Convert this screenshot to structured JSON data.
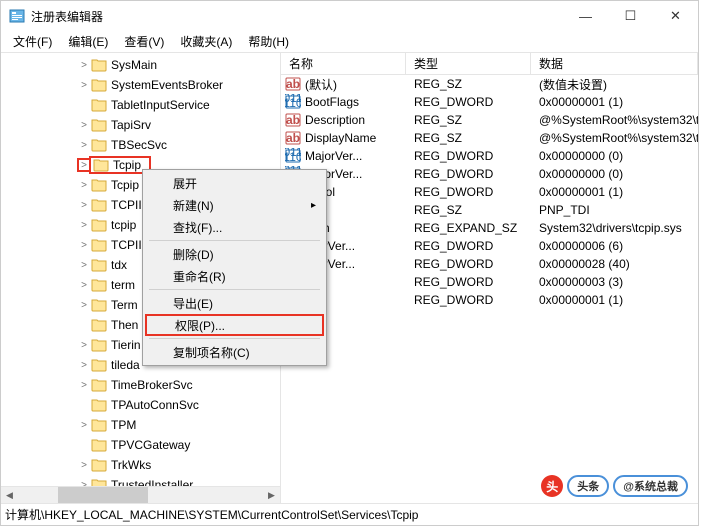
{
  "window": {
    "title": "注册表编辑器",
    "min": "—",
    "max": "☐",
    "close": "✕"
  },
  "menu": {
    "file": "文件(F)",
    "edit": "编辑(E)",
    "view": "查看(V)",
    "fav": "收藏夹(A)",
    "help": "帮助(H)"
  },
  "tree": {
    "items": [
      {
        "indent": 0,
        "chev": ">",
        "label": "SysMain"
      },
      {
        "indent": 0,
        "chev": ">",
        "label": "SystemEventsBroker"
      },
      {
        "indent": 0,
        "chev": "",
        "label": "TabletInputService"
      },
      {
        "indent": 0,
        "chev": ">",
        "label": "TapiSrv"
      },
      {
        "indent": 0,
        "chev": ">",
        "label": "TBSecSvc"
      },
      {
        "indent": 0,
        "chev": ">",
        "label": "Tcpip",
        "selected": true
      },
      {
        "indent": 0,
        "chev": ">",
        "label": "Tcpip"
      },
      {
        "indent": 0,
        "chev": ">",
        "label": "TCPII"
      },
      {
        "indent": 0,
        "chev": ">",
        "label": "tcpip"
      },
      {
        "indent": 0,
        "chev": ">",
        "label": "TCPII"
      },
      {
        "indent": 0,
        "chev": ">",
        "label": "tdx"
      },
      {
        "indent": 0,
        "chev": ">",
        "label": "term"
      },
      {
        "indent": 0,
        "chev": ">",
        "label": "Term"
      },
      {
        "indent": 0,
        "chev": "",
        "label": "Then"
      },
      {
        "indent": 0,
        "chev": ">",
        "label": "Tierin"
      },
      {
        "indent": 0,
        "chev": ">",
        "label": "tileda"
      },
      {
        "indent": 0,
        "chev": ">",
        "label": "TimeBrokerSvc"
      },
      {
        "indent": 0,
        "chev": "",
        "label": "TPAutoConnSvc"
      },
      {
        "indent": 0,
        "chev": ">",
        "label": "TPM"
      },
      {
        "indent": 0,
        "chev": "",
        "label": "TPVCGateway"
      },
      {
        "indent": 0,
        "chev": ">",
        "label": "TrkWks"
      },
      {
        "indent": 0,
        "chev": ">",
        "label": "TrustedInstaller"
      }
    ]
  },
  "columns": {
    "name": "名称",
    "type": "类型",
    "data": "数据"
  },
  "rows": [
    {
      "icon": "str",
      "name": "(默认)",
      "type": "REG_SZ",
      "data": "(数值未设置)"
    },
    {
      "icon": "bin",
      "name": "BootFlags",
      "type": "REG_DWORD",
      "data": "0x00000001 (1)"
    },
    {
      "icon": "str",
      "name": "Description",
      "type": "REG_SZ",
      "data": "@%SystemRoot%\\system32\\tc"
    },
    {
      "icon": "str",
      "name": "DisplayName",
      "type": "REG_SZ",
      "data": "@%SystemRoot%\\system32\\tc"
    },
    {
      "icon": "bin",
      "name": "MajorVer...",
      "type": "REG_DWORD",
      "data": "0x00000000 (0)"
    },
    {
      "icon": "bin",
      "name": "MinorVer...",
      "type": "REG_DWORD",
      "data": "0x00000000 (0)"
    },
    {
      "icon": "bin",
      "name": "ontrol",
      "type": "REG_DWORD",
      "data": "0x00000001 (1)"
    },
    {
      "icon": "str",
      "name": "",
      "type": "REG_SZ",
      "data": "PNP_TDI"
    },
    {
      "icon": "str",
      "name": "Path",
      "type": "REG_EXPAND_SZ",
      "data": "System32\\drivers\\tcpip.sys"
    },
    {
      "icon": "bin",
      "name": "lajorVer...",
      "type": "REG_DWORD",
      "data": "0x00000006 (6)"
    },
    {
      "icon": "bin",
      "name": "linorVer...",
      "type": "REG_DWORD",
      "data": "0x00000028 (40)"
    },
    {
      "icon": "bin",
      "name": "",
      "type": "REG_DWORD",
      "data": "0x00000003 (3)"
    },
    {
      "icon": "bin",
      "name": "",
      "type": "REG_DWORD",
      "data": "0x00000001 (1)"
    }
  ],
  "context_menu": {
    "expand": "展开",
    "new": "新建(N)",
    "find": "查找(F)...",
    "delete": "删除(D)",
    "rename": "重命名(R)",
    "export": "导出(E)",
    "permissions": "权限(P)...",
    "copykey": "复制项名称(C)"
  },
  "statusbar": "计算机\\HKEY_LOCAL_MACHINE\\SYSTEM\\CurrentControlSet\\Services\\Tcpip",
  "watermark": {
    "badge": "头",
    "text1": "头条",
    "text2": "@系统总裁"
  }
}
